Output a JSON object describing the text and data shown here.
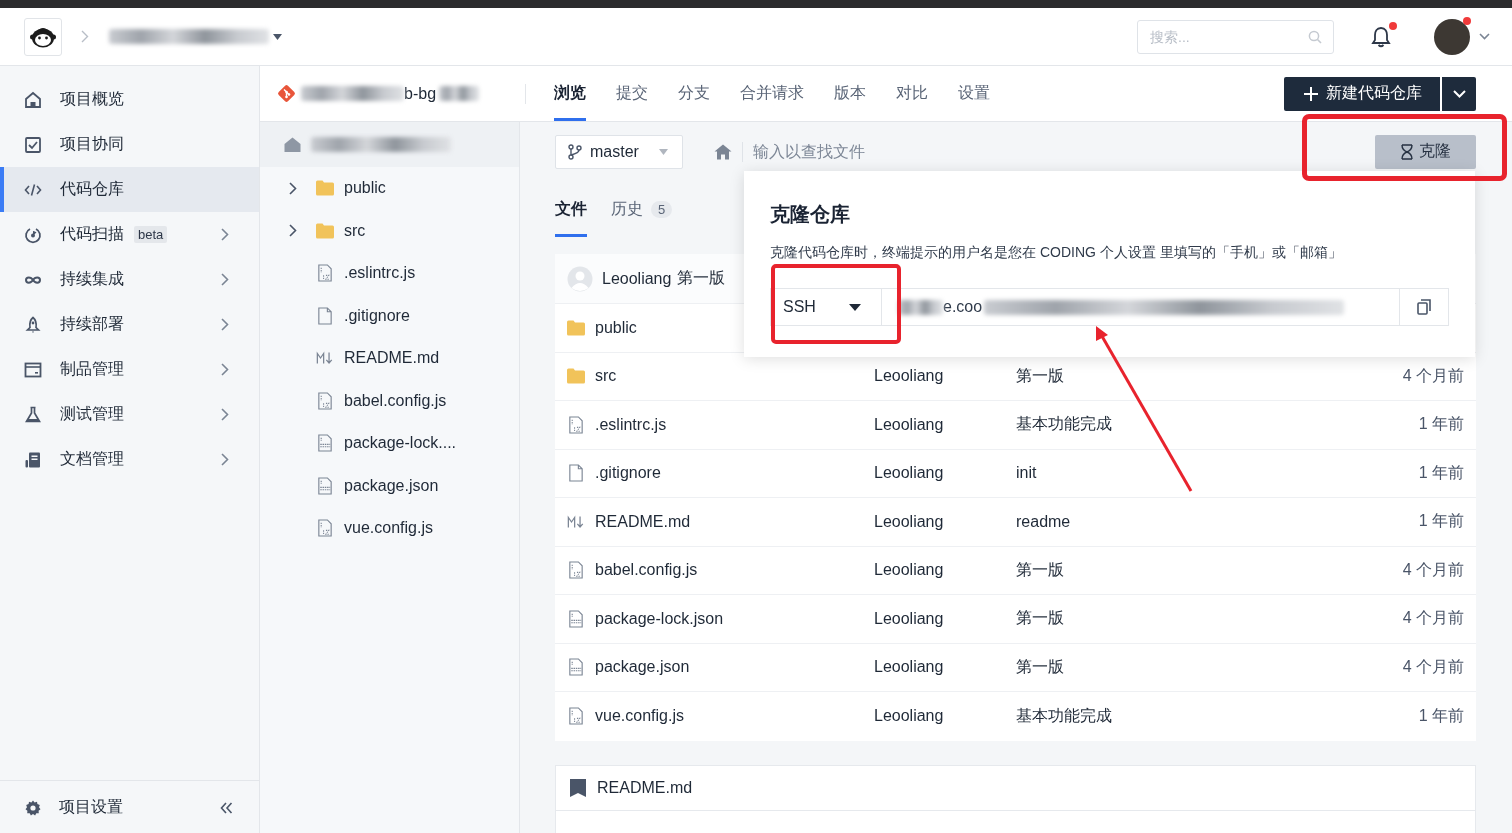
{
  "header": {
    "search": {
      "placeholder": "搜索..."
    },
    "notifications": {
      "unread": true
    },
    "avatar": {
      "unread": true
    }
  },
  "sidebar": {
    "items": [
      {
        "label": "项目概览",
        "selected": false,
        "expandable": false
      },
      {
        "label": "项目协同",
        "selected": false,
        "expandable": false
      },
      {
        "label": "代码仓库",
        "selected": true,
        "expandable": false
      },
      {
        "label": "代码扫描",
        "badge": "beta",
        "selected": false,
        "expandable": true
      },
      {
        "label": "持续集成",
        "selected": false,
        "expandable": true
      },
      {
        "label": "持续部署",
        "selected": false,
        "expandable": true
      },
      {
        "label": "制品管理",
        "selected": false,
        "expandable": true
      },
      {
        "label": "测试管理",
        "selected": false,
        "expandable": true
      },
      {
        "label": "文档管理",
        "selected": false,
        "expandable": true
      }
    ],
    "footer": {
      "label": "项目设置"
    }
  },
  "repo_bar": {
    "name_fragment": "b-bg",
    "tabs": [
      {
        "label": "浏览",
        "selected": true
      },
      {
        "label": "提交",
        "selected": false
      },
      {
        "label": "分支",
        "selected": false
      },
      {
        "label": "合并请求",
        "selected": false
      },
      {
        "label": "版本",
        "selected": false
      },
      {
        "label": "对比",
        "selected": false
      },
      {
        "label": "设置",
        "selected": false
      }
    ],
    "new_button": "新建代码仓库"
  },
  "tree": {
    "items": [
      {
        "name": "public",
        "kind": "folder",
        "expanded": false
      },
      {
        "name": "src",
        "kind": "folder",
        "expanded": false
      },
      {
        "name": ".eslintrc.js",
        "kind": "js"
      },
      {
        "name": ".gitignore",
        "kind": "file"
      },
      {
        "name": "README.md",
        "kind": "markdown"
      },
      {
        "name": "babel.config.js",
        "kind": "js"
      },
      {
        "name": "package-lock....",
        "kind": "json"
      },
      {
        "name": "package.json",
        "kind": "json"
      },
      {
        "name": "vue.config.js",
        "kind": "js"
      }
    ]
  },
  "files_panel": {
    "branch": "master",
    "search": {
      "placeholder": "输入以查找文件"
    },
    "clone_button": "克隆",
    "subtabs": [
      {
        "label": "文件",
        "selected": true
      },
      {
        "label": "历史",
        "count": "5",
        "selected": false
      }
    ],
    "last_commit": {
      "author": "Leooliang",
      "message": "第一版"
    },
    "rows": [
      {
        "name": "public",
        "kind": "folder"
      },
      {
        "name": "src",
        "kind": "folder",
        "author": "Leooliang",
        "message": "第一版",
        "time": "4 个月前"
      },
      {
        "name": ".eslintrc.js",
        "kind": "js",
        "author": "Leooliang",
        "message": "基本功能完成",
        "time": "1 年前"
      },
      {
        "name": ".gitignore",
        "kind": "file",
        "author": "Leooliang",
        "message": "init",
        "time": "1 年前"
      },
      {
        "name": "README.md",
        "kind": "markdown",
        "author": "Leooliang",
        "message": "readme",
        "time": "1 年前"
      },
      {
        "name": "babel.config.js",
        "kind": "js",
        "author": "Leooliang",
        "message": "第一版",
        "time": "4 个月前"
      },
      {
        "name": "package-lock.json",
        "kind": "json",
        "author": "Leooliang",
        "message": "第一版",
        "time": "4 个月前"
      },
      {
        "name": "package.json",
        "kind": "json",
        "author": "Leooliang",
        "message": "第一版",
        "time": "4 个月前"
      },
      {
        "name": "vue.config.js",
        "kind": "js",
        "author": "Leooliang",
        "message": "基本功能完成",
        "time": "1 年前"
      }
    ],
    "readme": {
      "title": "README.md"
    }
  },
  "clone_popup": {
    "title": "克隆仓库",
    "description": "克隆代码仓库时，终端提示的用户名是您在 CODING 个人设置 里填写的「手机」或「邮箱」",
    "protocol": "SSH",
    "url_fragment": "e.coo"
  },
  "annotations": {
    "highlight_clone_button": true,
    "highlight_protocol": true,
    "arrow_to_url": true
  }
}
